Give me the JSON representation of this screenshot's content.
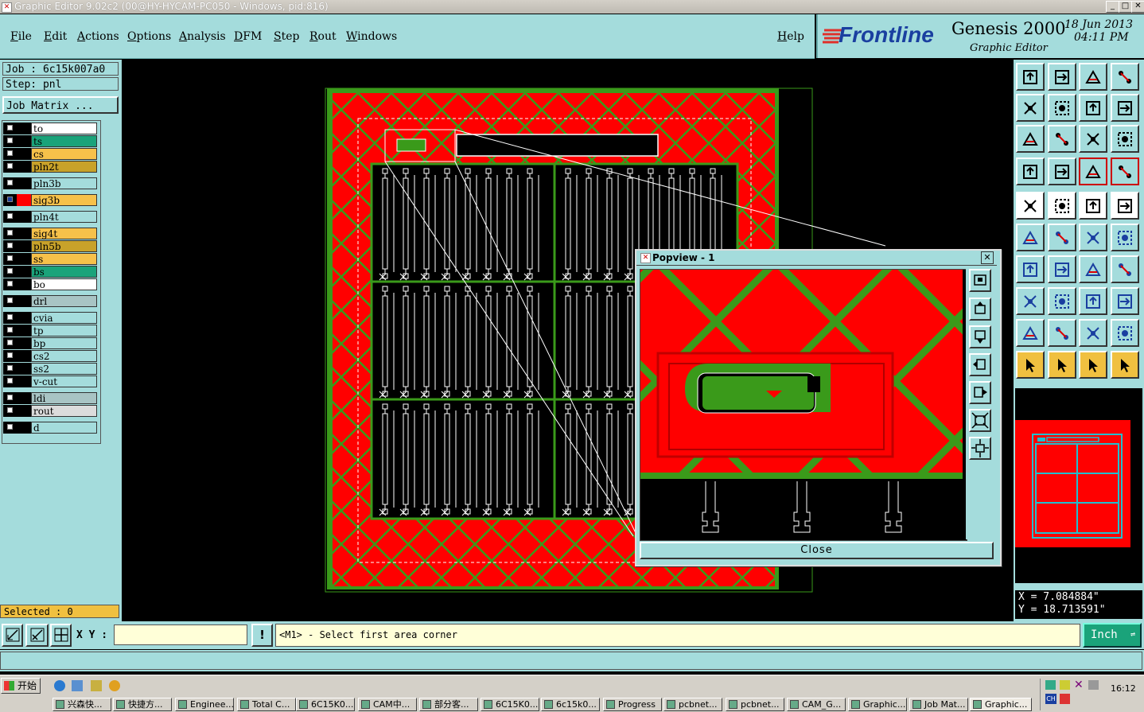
{
  "window": {
    "title": "Graphic Editor 9.02c2 (00@HY-HYCAM-PC050 - Windows, pid:816)"
  },
  "menu": {
    "file": "File",
    "edit": "Edit",
    "actions": "Actions",
    "options": "Options",
    "analysis": "Analysis",
    "dfm": "DFM",
    "step": "Step",
    "rout": "Rout",
    "windows": "Windows",
    "help": "Help"
  },
  "brand": {
    "logo": "Frontline",
    "product": "Genesis 2000",
    "subtitle": "Graphic Editor",
    "date": "18 Jun 2013",
    "time": "04:11 PM"
  },
  "job": {
    "job_label": "Job : 6c15k007a0",
    "step_label": "Step: pnl",
    "matrix_button": "Job Matrix ..."
  },
  "layers": [
    {
      "name": "to",
      "color": "#ffffff"
    },
    {
      "name": "ts",
      "color": "#1aa37a"
    },
    {
      "name": "cs",
      "color": "#f6c14a"
    },
    {
      "name": "pln2t",
      "color": "#c8a22a"
    },
    {
      "name": "pln3b",
      "color": "#a4dcdc"
    },
    {
      "name": "sig3b",
      "color": "#f6c14a"
    },
    {
      "name": "pln4t",
      "color": "#a4dcdc"
    },
    {
      "name": "sig4t",
      "color": "#f6c14a"
    },
    {
      "name": "pln5b",
      "color": "#c8a22a"
    },
    {
      "name": "ss",
      "color": "#f6c14a"
    },
    {
      "name": "bs",
      "color": "#1aa37a"
    },
    {
      "name": "bo",
      "color": "#ffffff"
    },
    {
      "name": "drl",
      "color": "#a8c4c4"
    },
    {
      "name": "cvia",
      "color": "#a4dcdc"
    },
    {
      "name": "tp",
      "color": "#a4dcdc"
    },
    {
      "name": "bp",
      "color": "#a4dcdc"
    },
    {
      "name": "cs2",
      "color": "#a4dcdc"
    },
    {
      "name": "ss2",
      "color": "#a4dcdc"
    },
    {
      "name": "v-cut",
      "color": "#a4dcdc"
    },
    {
      "name": "ldi",
      "color": "#a8c4c4"
    },
    {
      "name": "rout",
      "color": "#dcdcdc"
    },
    {
      "name": "d",
      "color": "#a4dcdc"
    }
  ],
  "status": {
    "selected": "Selected : 0"
  },
  "coords": {
    "x": "X = 7.084884\"",
    "y": "Y = 18.713591\""
  },
  "input": {
    "xy_label": "X Y :",
    "xy_value": "",
    "prompt": "<M1> - Select first area corner",
    "units": "Inch"
  },
  "popup": {
    "title": "Popview - 1",
    "close_label": "Close"
  },
  "taskbar": {
    "start": "开始",
    "clock": "16:12",
    "tasks": [
      "兴森快...",
      "快捷方...",
      "Enginee...",
      "Total C...",
      "6C15K0...",
      "CAM中...",
      "部分客...",
      "6C15K0...",
      "6c15k0...",
      "Progress",
      "pcbnet...",
      "pcbnet...",
      "CAM_G...",
      "Graphic...",
      "Job Mat...",
      "Graphic..."
    ]
  },
  "colors": {
    "panel": "#a4dcdc",
    "copper": "#ff0000",
    "board_green": "#3a9a1a",
    "accent": "#f0c040"
  }
}
